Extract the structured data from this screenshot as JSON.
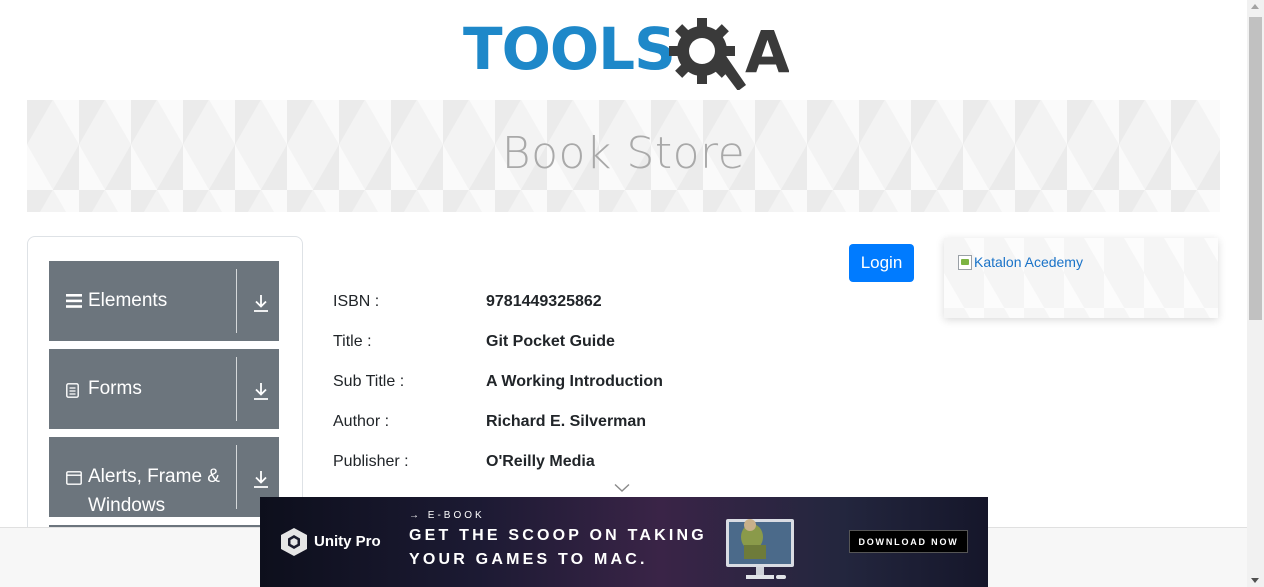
{
  "logo": {
    "text": "TOOLS",
    "suffix": "A"
  },
  "banner": {
    "title": "Book Store"
  },
  "sidebar": {
    "groups": [
      {
        "label": "Elements",
        "icon": "menu-icon"
      },
      {
        "label": "Forms",
        "icon": "document-icon"
      },
      {
        "label": "Alerts, Frame &",
        "label2": "Windows",
        "icon": "window-icon"
      }
    ]
  },
  "login_label": "Login",
  "book": {
    "rows": [
      {
        "key": "ISBN :",
        "value": "9781449325862"
      },
      {
        "key": "Title :",
        "value": "Git Pocket Guide"
      },
      {
        "key": "Sub Title :",
        "value": "A Working Introduction"
      },
      {
        "key": "Author :",
        "value": "Richard E. Silverman"
      },
      {
        "key": "Publisher :",
        "value": "O'Reilly Media"
      }
    ]
  },
  "side_ad": {
    "alt": "Katalon Acedemy"
  },
  "bottom_ad": {
    "brand": "Unity Pro",
    "kicker": "→ E-BOOK",
    "line1": "GET THE SCOOP ON TAKING",
    "line2": "YOUR GAMES TO MAC.",
    "cta": "DOWNLOAD NOW"
  },
  "colors": {
    "primary": "#007bff",
    "sidebar": "#6c757d",
    "logo_blue": "#1e88c9",
    "logo_dark": "#3a3a3a"
  }
}
